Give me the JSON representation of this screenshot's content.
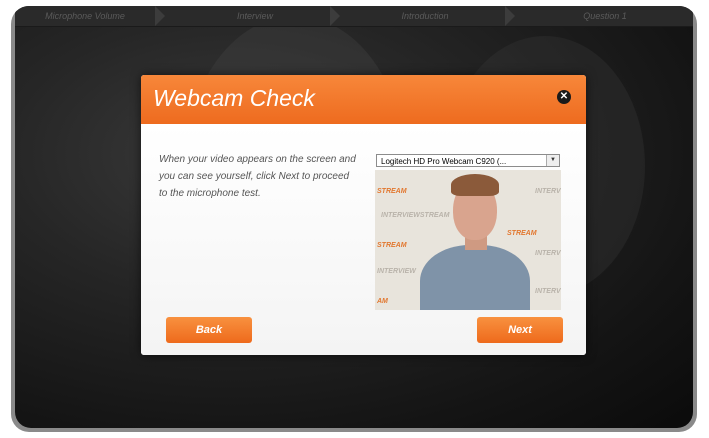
{
  "progress_steps": [
    "Microphone Volume",
    "Interview",
    "Introduction",
    "Question 1"
  ],
  "dialog": {
    "title": "Webcam Check",
    "close_glyph": "✕",
    "instructions": "When your video appears on the screen and you can see yourself, click Next to proceed to the microphone test.",
    "camera_select_value": "Logitech HD Pro Webcam C920 (...",
    "back_label": "Back",
    "next_label": "Next"
  },
  "video_watermarks": [
    "STREAM",
    "INTERVIEWSTREAM",
    "INTERV",
    "INTERVIEW",
    "STREAM",
    "INTERV",
    "INTERV",
    "STREAM",
    "AM"
  ],
  "colors": {
    "accent_orange": "#ee6b1f",
    "accent_orange_light": "#f7873a",
    "watermark_orange": "#e2772f",
    "watermark_gray": "#b9b3aa"
  }
}
